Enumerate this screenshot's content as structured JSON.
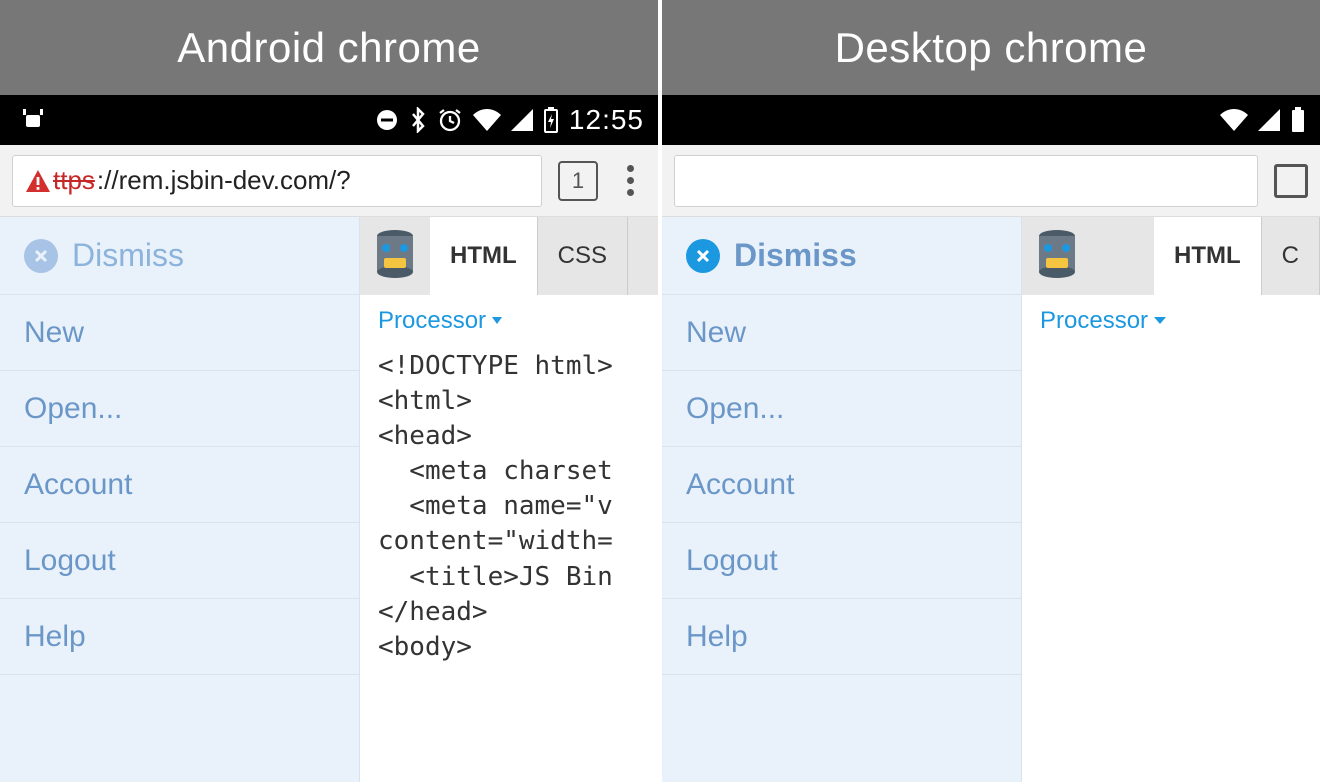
{
  "left": {
    "title": "Android chrome",
    "status": {
      "clock": "12:55"
    },
    "address": {
      "scheme": "ttps",
      "rest": "://rem.jsbin-dev.com/?",
      "tab_count": "1"
    },
    "sidebar": {
      "dismiss": "Dismiss",
      "items": [
        "New",
        "Open...",
        "Account",
        "Logout",
        "Help"
      ]
    },
    "editor": {
      "tabs": [
        "HTML",
        "CSS"
      ],
      "active_tab": 0,
      "processor": "Processor",
      "code": "<!DOCTYPE html>\n<html>\n<head>\n  <meta charset\n  <meta name=\"v\ncontent=\"width=\n  <title>JS Bin\n</head>\n<body>"
    }
  },
  "right": {
    "title": "Desktop chrome",
    "sidebar": {
      "dismiss": "Dismiss",
      "items": [
        "New",
        "Open...",
        "Account",
        "Logout",
        "Help"
      ]
    },
    "editor": {
      "tabs": [
        "HTML",
        "C"
      ],
      "active_tab": 0,
      "processor": "Processor"
    }
  }
}
